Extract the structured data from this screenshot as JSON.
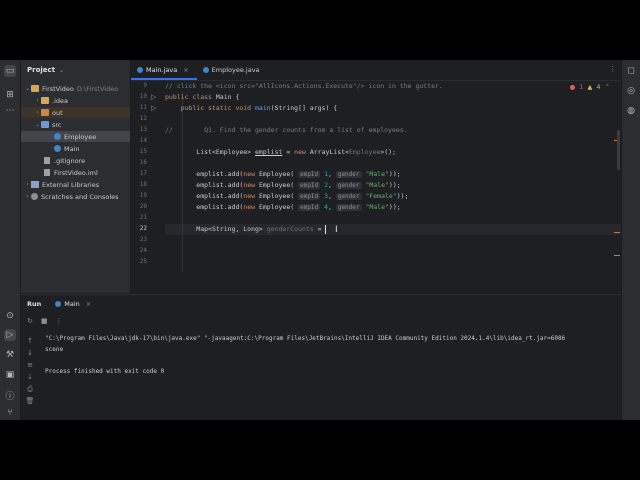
{
  "project": {
    "title": "Project",
    "items": [
      {
        "name": "FirstVideo",
        "path": "D:\\FirstVideo"
      },
      {
        "name": ".idea"
      },
      {
        "name": "out"
      },
      {
        "name": "src"
      },
      {
        "name": "Employee"
      },
      {
        "name": "Main"
      },
      {
        "name": ".gitignore"
      },
      {
        "name": "FirstVideo.iml"
      },
      {
        "name": "External Libraries"
      },
      {
        "name": "Scratches and Consoles"
      }
    ]
  },
  "editor": {
    "tabs": [
      {
        "label": "Main.java"
      },
      {
        "label": "Employee.java"
      }
    ],
    "tab_close": "×",
    "more": "⋮",
    "errors": "1",
    "warnings": "4",
    "line_numbers": [
      "9",
      "10",
      "11",
      "12",
      "13",
      "14",
      "15",
      "16",
      "17",
      "18",
      "19",
      "20",
      "21",
      "22",
      "23",
      "24",
      "25"
    ],
    "lines": {
      "l1": "// click the <icon src=\"AllIcons.Actions.Execute\"/> icon in the gutter.",
      "l2a": "public class ",
      "l2b": "Main {",
      "l3a": "    public static void ",
      "l3b": "main",
      "l3c": "(String[] args) {",
      "l5a": "//",
      "l5b": "        Q1. Find the gender counts from a list of employees.",
      "l7a": "        List<Employee> ",
      "l7b": "emplist",
      "l7c": " = ",
      "l7d": "new ",
      "l7e": "ArrayList<",
      "l7f": "Employee",
      "l7g": ">();",
      "emp_prefix": "        emplist.add(",
      "emp_new": "new ",
      "emp_class": "Employee(",
      "emp_hint_id": "empId",
      "emp_hint_gender": "gender",
      "emp_close": "));",
      "emp1_id": " 1",
      "emp1_gender": "\"Male\"",
      "emp2_id": " 2",
      "emp2_gender": "\"Male\"",
      "emp3_id": " 3",
      "emp3_gender": "\"Female\"",
      "emp4_id": " 4",
      "emp4_gender": "\"Male\"",
      "l15a": "        Map<String, Long> ",
      "l15b": "genderCounts",
      "l15c": " = ",
      "comma": ","
    }
  },
  "run": {
    "title": "Run",
    "tab": "Main",
    "tab_close": "×",
    "console": [
      "\"C:\\Program Files\\Java\\jdk-17\\bin\\java.exe\" \"-javaagent:C:\\Program Files\\JetBrains\\IntelliJ IDEA Community Edition 2024.1.4\\lib\\idea_rt.jar=6086",
      "scene",
      "",
      "Process finished with exit code 0"
    ]
  },
  "colors": {
    "accent": "#3574f0",
    "keyword": "#cf8e6d",
    "string": "#6aab73",
    "function": "#56a8f5",
    "number": "#2aacb8",
    "error": "#e55c5c",
    "warning": "#e0b44c"
  },
  "icons": [
    "folder-icon",
    "structure-icon",
    "more-icon",
    "run-icon",
    "terminal-icon",
    "problems-icon",
    "git-icon",
    "build-icon",
    "notifications-icon",
    "database-icon",
    "ai-assistant-icon",
    "rerun-icon",
    "stop-icon",
    "class-icon"
  ]
}
